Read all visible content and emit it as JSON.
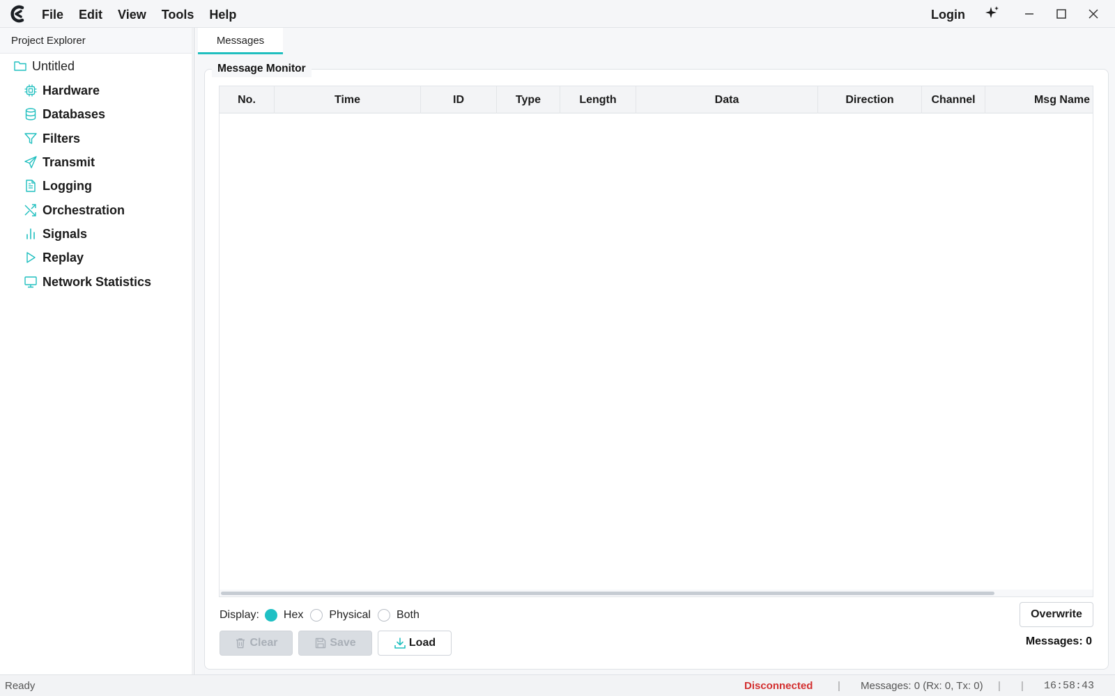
{
  "menu": {
    "items": [
      "File",
      "Edit",
      "View",
      "Tools",
      "Help"
    ],
    "login": "Login"
  },
  "colors": {
    "accent": "#1fbfbf",
    "error": "#d32f2f"
  },
  "left_panel": {
    "title": "Project Explorer",
    "root": {
      "label": "Untitled",
      "icon": "folder-icon"
    },
    "items": [
      {
        "label": "Hardware",
        "icon": "chip-icon"
      },
      {
        "label": "Databases",
        "icon": "database-icon"
      },
      {
        "label": "Filters",
        "icon": "filter-icon"
      },
      {
        "label": "Transmit",
        "icon": "send-icon"
      },
      {
        "label": "Logging",
        "icon": "document-icon"
      },
      {
        "label": "Orchestration",
        "icon": "shuffle-icon"
      },
      {
        "label": "Signals",
        "icon": "bar-chart-icon"
      },
      {
        "label": "Replay",
        "icon": "play-icon"
      },
      {
        "label": "Network Statistics",
        "icon": "monitor-icon"
      }
    ]
  },
  "tabs": [
    {
      "label": "Messages",
      "active": true
    }
  ],
  "monitor": {
    "title": "Message Monitor",
    "columns": [
      "No.",
      "Time",
      "ID",
      "Type",
      "Length",
      "Data",
      "Direction",
      "Channel",
      "Msg Name"
    ],
    "rows": [],
    "display_label": "Display:",
    "display_options": [
      "Hex",
      "Physical",
      "Both"
    ],
    "display_selected": "Hex",
    "buttons": {
      "clear": "Clear",
      "save": "Save",
      "load": "Load",
      "overwrite": "Overwrite"
    },
    "message_count": "Messages: 0"
  },
  "status": {
    "ready": "Ready",
    "connection": "Disconnected",
    "separator": "|",
    "messages": "Messages: 0 (Rx: 0, Tx: 0)",
    "time": "16:58:43"
  }
}
